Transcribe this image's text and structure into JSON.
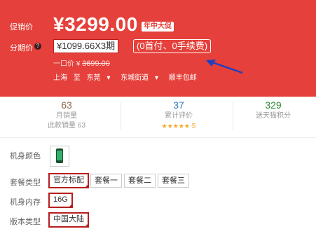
{
  "promo": {
    "promo_label": "促销价",
    "price": "¥3299.00",
    "badge": "年中大促",
    "installment_label": "分期价",
    "installment_value": "¥1099.66X3期",
    "installment_note": "(0首付、0手续费)",
    "once_price_label": "一口价 ¥",
    "once_price_value": "3699.00",
    "ship_from": "上海",
    "ship_to_word": "至",
    "ship_city": "东莞",
    "ship_district": "东城街道",
    "ship_carrier": "顺丰包邮"
  },
  "stats": [
    {
      "num": "63",
      "line1": "月销量",
      "line2": "此款销量 63",
      "color": "#8c6a4f"
    },
    {
      "num": "37",
      "line1": "累计评价",
      "line2": "5",
      "color": "#2c7ab8"
    },
    {
      "num": "329",
      "line1": "送天猫积分",
      "line2": "",
      "color": "#2f8a3a"
    }
  ],
  "stars": "★★★★★",
  "options": {
    "color_label": "机身颜色",
    "package_label": "套餐类型",
    "packages": [
      "官方标配",
      "套餐一",
      "套餐二",
      "套餐三"
    ],
    "memory_label": "机身内存",
    "memory": "16G",
    "version_label": "版本类型",
    "version": "中国大陆"
  },
  "colors": {
    "promo_bg": "#e5403b",
    "selected_border": "#b71e1e",
    "arrow": "#1f3fbf"
  }
}
